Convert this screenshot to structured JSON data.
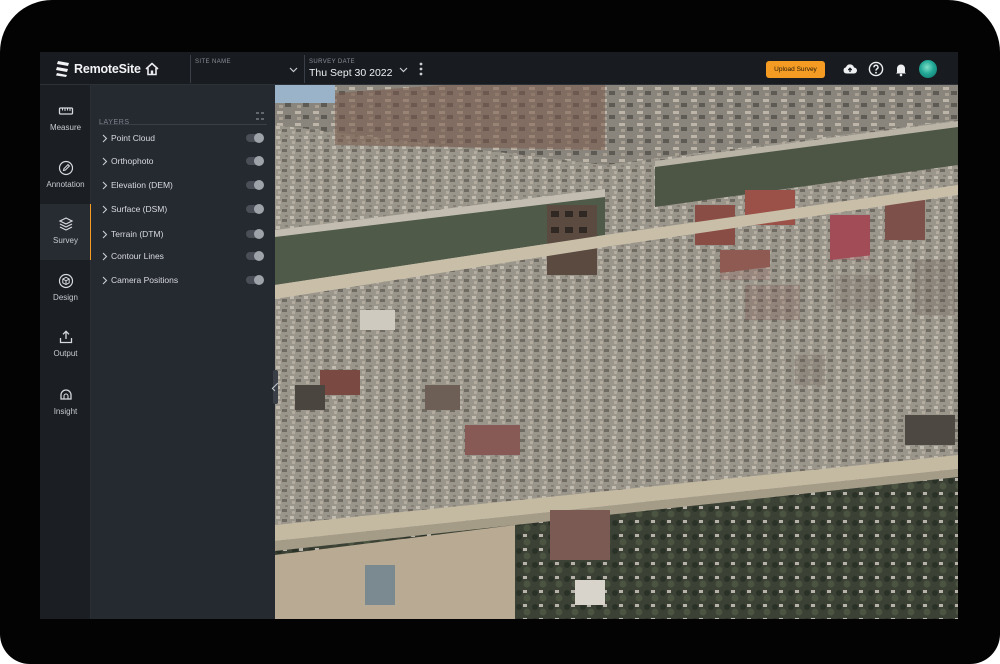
{
  "app": {
    "name": "RemoteSite"
  },
  "header": {
    "site_field": {
      "label": "SITE NAME",
      "value": ""
    },
    "date_field": {
      "label": "SURVEY DATE",
      "value": "Thu Sept 30 2022"
    },
    "upload_label": "Upload Survey",
    "icons": [
      "cloud-upload-icon",
      "help-icon",
      "bell-icon",
      "avatar"
    ]
  },
  "rail": {
    "items": [
      {
        "label": "Measure",
        "icon": "ruler-icon"
      },
      {
        "label": "Annotation",
        "icon": "pencil-icon"
      },
      {
        "label": "Survey",
        "icon": "layers-icon",
        "active": true
      },
      {
        "label": "Design",
        "icon": "cube-icon"
      },
      {
        "label": "Output",
        "icon": "export-icon"
      },
      {
        "label": "Insight",
        "icon": "insight-icon"
      }
    ]
  },
  "layers_panel": {
    "title": "LAYERS",
    "items": [
      {
        "label": "Point Cloud",
        "enabled": false
      },
      {
        "label": "Orthophoto",
        "enabled": false
      },
      {
        "label": "Elevation (DEM)",
        "enabled": false
      },
      {
        "label": "Surface (DSM)",
        "enabled": false
      },
      {
        "label": "Terrain (DTM)",
        "enabled": false
      },
      {
        "label": "Contour Lines",
        "enabled": false
      },
      {
        "label": "Camera Positions",
        "enabled": false
      }
    ]
  },
  "colors": {
    "accent": "#f39b23",
    "topbar": "#181b20",
    "panel": "#252930",
    "rail": "#1b1e23"
  }
}
